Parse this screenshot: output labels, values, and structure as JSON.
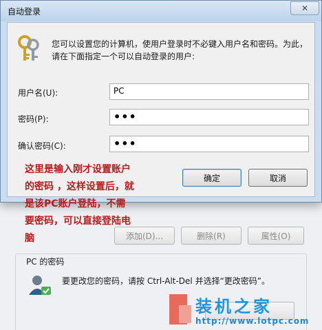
{
  "dialog": {
    "title": "自动登录",
    "close_glyph": "✕",
    "description_line1": "您可以设置您的计算机，使用户登录时不必键入用户名和密码。为此，",
    "description_line2": "请在下面指定一个可以自动登录的用户:",
    "username_label": "用户名(U):",
    "username_value": "PC",
    "password_label": "密码(P):",
    "password_value": "•••",
    "confirm_label": "确认密码(C):",
    "confirm_value": "•••",
    "ok_label": "确定",
    "cancel_label": "取消"
  },
  "background": {
    "add_label": "添加(D)...",
    "remove_label": "删除(R)",
    "properties_label": "属性(O)",
    "group_title": "PC 的密码",
    "password_hint": "要更改您的密码，请按 Ctrl-Alt-Del 并选择“更改密码”。"
  },
  "annotation": {
    "line1": "这里是输入刚才设置账户",
    "line2": "的密码 ，这样设置后，就",
    "line3": "是该PC账户登陆，不需",
    "line4": "要密码，可以直接登陆电",
    "line5": "脑"
  },
  "watermark": {
    "title": "装机之家",
    "url": "http://www.lotpc.com"
  },
  "colors": {
    "annotation": "#b71c1c",
    "watermark_blue": "#2196d9",
    "titlebar": "#bcd3ea"
  }
}
